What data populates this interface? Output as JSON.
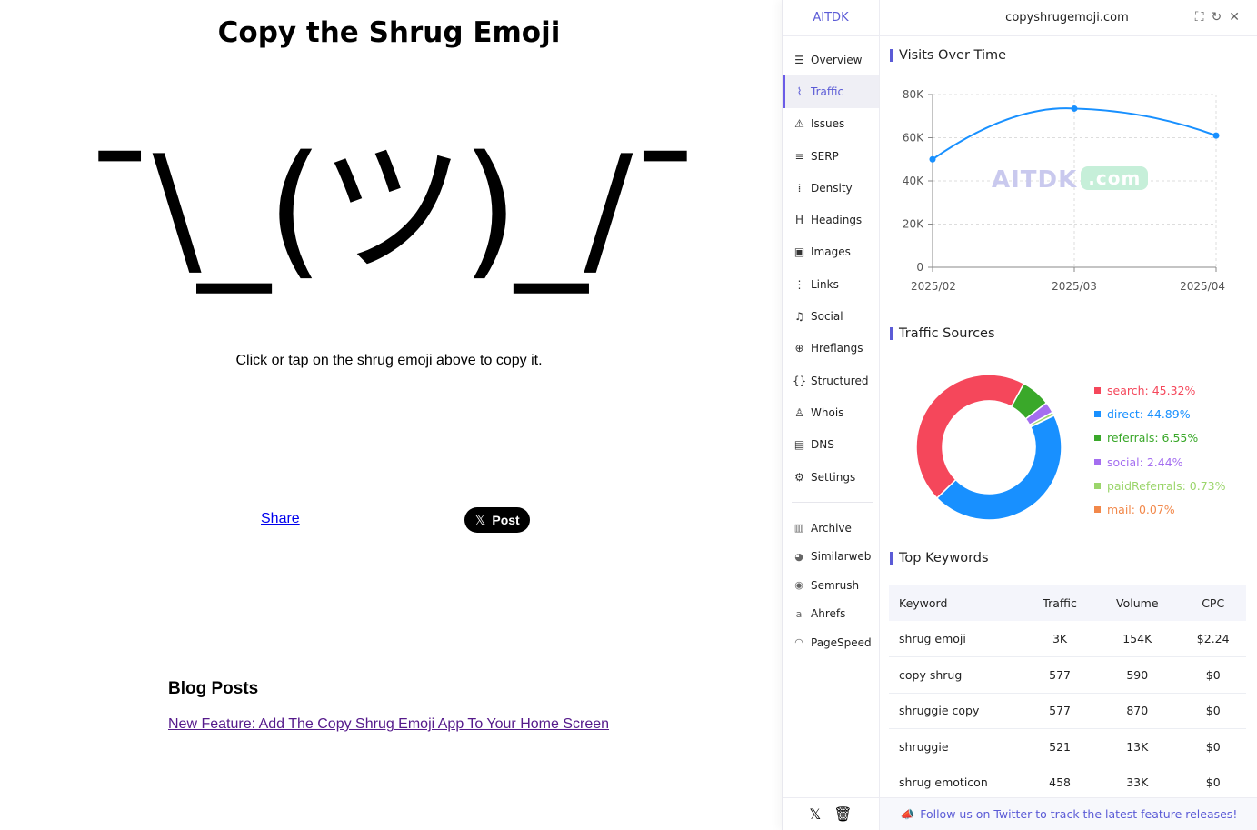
{
  "page": {
    "title": "Copy the Shrug Emoji",
    "shrug": "¯\\_(ツ)_/¯",
    "instruction": "Click or tap on the shrug emoji above to copy it.",
    "share_label": "Share",
    "post_label": "Post",
    "post_icon": "𝕏",
    "blog_heading": "Blog Posts",
    "blog_link": "New Feature: Add The Copy Shrug Emoji App To Your Home Screen"
  },
  "panel": {
    "brand": "AITDK",
    "domain": "copyshrugemoji.com",
    "top_icons": [
      {
        "name": "crop-icon",
        "glyph": "⛶"
      },
      {
        "name": "refresh-icon",
        "glyph": "↻"
      },
      {
        "name": "close-icon",
        "glyph": "✕"
      }
    ],
    "nav": [
      {
        "label": "Overview",
        "icon": "overview-icon",
        "glyph": "☰"
      },
      {
        "label": "Traffic",
        "icon": "traffic-icon",
        "glyph": "⌇"
      },
      {
        "label": "Issues",
        "icon": "warning-icon",
        "glyph": "⚠"
      },
      {
        "label": "SERP",
        "icon": "serp-icon",
        "glyph": "≡"
      },
      {
        "label": "Density",
        "icon": "density-icon",
        "glyph": "⁞"
      },
      {
        "label": "Headings",
        "icon": "heading-icon",
        "glyph": "H"
      },
      {
        "label": "Images",
        "icon": "image-icon",
        "glyph": "▣"
      },
      {
        "label": "Links",
        "icon": "links-icon",
        "glyph": "⋮"
      },
      {
        "label": "Social",
        "icon": "social-icon",
        "glyph": "♫"
      },
      {
        "label": "Hreflangs",
        "icon": "globe-icon",
        "glyph": "⊕"
      },
      {
        "label": "Structured",
        "icon": "braces-icon",
        "glyph": "{}"
      },
      {
        "label": "Whois",
        "icon": "user-search-icon",
        "glyph": "♙"
      },
      {
        "label": "DNS",
        "icon": "server-icon",
        "glyph": "▤"
      },
      {
        "label": "Settings",
        "icon": "gear-icon",
        "glyph": "⚙"
      }
    ],
    "active_nav": "Traffic",
    "external": [
      {
        "label": "Archive",
        "icon": "archive-icon",
        "glyph": "▥"
      },
      {
        "label": "Similarweb",
        "icon": "similarweb-icon",
        "glyph": "◕"
      },
      {
        "label": "Semrush",
        "icon": "semrush-icon",
        "glyph": "◉"
      },
      {
        "label": "Ahrefs",
        "icon": "ahrefs-icon",
        "glyph": "a"
      },
      {
        "label": "PageSpeed",
        "icon": "pagespeed-icon",
        "glyph": "◠"
      }
    ],
    "sidebar_footer": [
      {
        "name": "x-twitter-icon",
        "glyph": "𝕏"
      },
      {
        "name": "trash-icon",
        "glyph": "🗑"
      }
    ],
    "visits_title": "Visits Over Time",
    "sources_title": "Traffic Sources",
    "keywords_title": "Top Keywords",
    "watermark": {
      "main": "AITDK",
      "suffix": ".com"
    },
    "keywords": {
      "columns": [
        "Keyword",
        "Traffic",
        "Volume",
        "CPC"
      ],
      "rows": [
        [
          "shrug emoji",
          "3K",
          "154K",
          "$2.24"
        ],
        [
          "copy shrug",
          "577",
          "590",
          "$0"
        ],
        [
          "shruggie copy",
          "577",
          "870",
          "$0"
        ],
        [
          "shruggie",
          "521",
          "13K",
          "$0"
        ],
        [
          "shrug emoticon",
          "458",
          "33K",
          "$0"
        ]
      ]
    },
    "footer": {
      "icon": "megaphone-icon",
      "glyph": "📣",
      "text": "Follow us on Twitter to track the latest feature releases!"
    }
  },
  "chart_data": [
    {
      "type": "line",
      "title": "Visits Over Time",
      "x": [
        "2025/02",
        "2025/03",
        "2025/04"
      ],
      "series": [
        {
          "values": [
            50000,
            73500,
            61000
          ]
        }
      ],
      "ylim": [
        0,
        80000
      ],
      "yticks": [
        "0",
        "20K",
        "40K",
        "60K",
        "80K"
      ],
      "grid": true,
      "color": "#1890ff"
    },
    {
      "type": "pie",
      "title": "Traffic Sources",
      "donut": true,
      "slices": [
        {
          "label": "search",
          "value": 45.32,
          "text": "search: 45.32%",
          "color": "#f5475b"
        },
        {
          "label": "direct",
          "value": 44.89,
          "text": "direct: 44.89%",
          "color": "#1890ff"
        },
        {
          "label": "referrals",
          "value": 6.55,
          "text": "referrals: 6.55%",
          "color": "#3aa82a"
        },
        {
          "label": "social",
          "value": 2.44,
          "text": "social: 2.44%",
          "color": "#a46ef0"
        },
        {
          "label": "paidReferrals",
          "value": 0.73,
          "text": "paidReferrals: 0.73%",
          "color": "#9bd56b"
        },
        {
          "label": "mail",
          "value": 0.07,
          "text": "mail: 0.07%",
          "color": "#f2884a"
        }
      ],
      "legend": "right"
    }
  ]
}
